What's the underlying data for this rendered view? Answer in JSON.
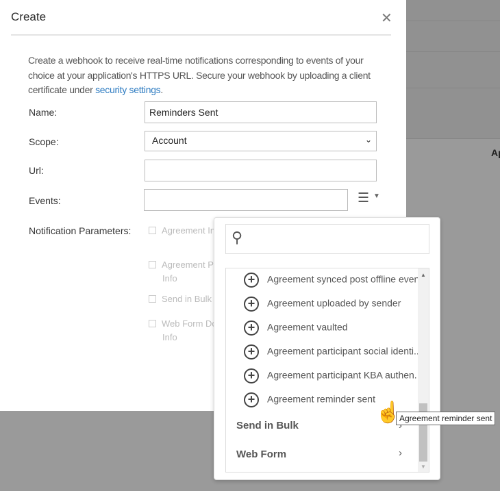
{
  "background": {
    "partial_column_text": "Ap"
  },
  "modal": {
    "title": "Create",
    "close_icon": "close-icon",
    "description_prefix": "Create a webhook to receive real-time notifications corresponding to events of your choice at your application's HTTPS URL. Secure your webhook by uploading a client certificate under ",
    "description_link": "security settings",
    "description_suffix": ".",
    "name_label": "Name:",
    "name_value": "Reminders Sent",
    "scope_label": "Scope:",
    "scope_value": "Account",
    "url_label": "Url:",
    "url_value": "",
    "events_label": "Events:",
    "events_value": "",
    "notification_label": "Notification Parameters:",
    "notification_params": [
      {
        "line1": "Agreement Info",
        "line2": ""
      },
      {
        "line1": "Agreement Participant",
        "line2": "Info"
      },
      {
        "line1": "Send in Bulk Info",
        "line2": ""
      },
      {
        "line1": "Web Form Document",
        "line2": "Info"
      }
    ]
  },
  "dropdown": {
    "search_value": "",
    "items": [
      "Agreement synced post offline event",
      "Agreement uploaded by sender",
      "Agreement vaulted",
      "Agreement participant social identi...",
      "Agreement participant KBA authen...",
      "Agreement reminder sent"
    ],
    "groups": [
      "Send in Bulk",
      "Web Form"
    ],
    "tooltip": "Agreement reminder sent"
  },
  "colors": {
    "link": "#2d7bc1",
    "overlay": "#9a9a9a"
  }
}
